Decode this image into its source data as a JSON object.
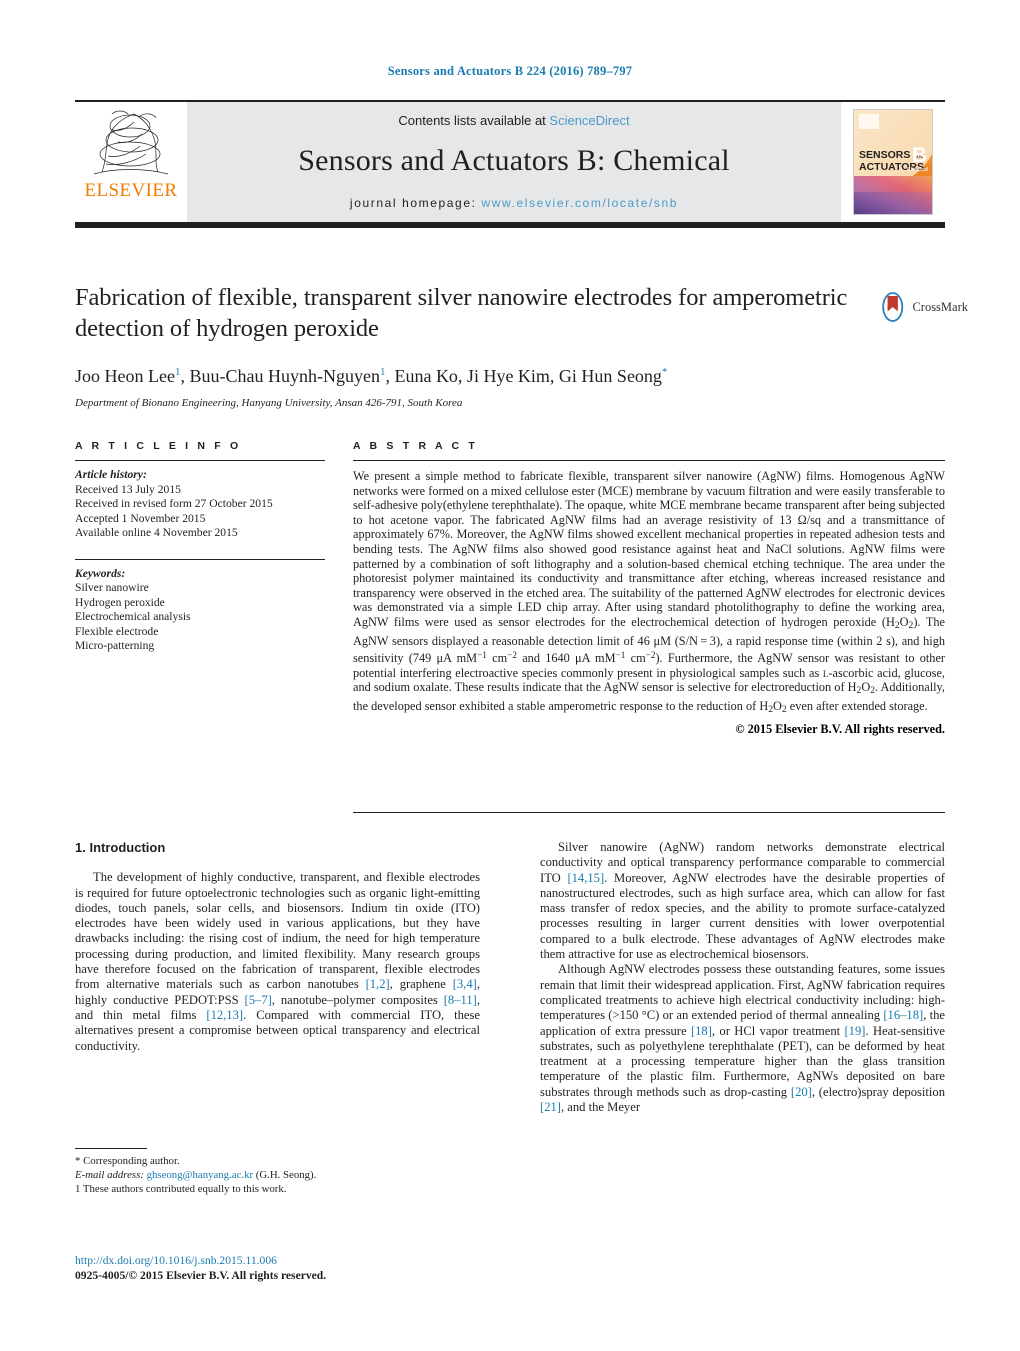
{
  "running_head": "Sensors and Actuators B 224 (2016) 789–797",
  "masthead": {
    "publisher": "ELSEVIER",
    "contents_prefix": "Contents lists available at ",
    "contents_link": "ScienceDirect",
    "journal_name": "Sensors and Actuators B: Chemical",
    "homepage_prefix": "journal homepage: ",
    "homepage_url": "www.elsevier.com/locate/snb",
    "cover": {
      "line1": "SENSORS",
      "line1_small": "and",
      "line2": "ACTUATORS",
      "letter": "B",
      "letter_sub": "Chemical"
    }
  },
  "article": {
    "title": "Fabrication of flexible, transparent silver nanowire electrodes for amperometric detection of hydrogen peroxide",
    "authors_html": "Joo Heon Lee<sup>1</sup>, Buu-Chau Huynh-Nguyen<sup>1</sup>, Euna Ko, Ji Hye Kim, Gi Hun Seong<sup class=\"star\">*</sup>",
    "affiliation": "Department of Bionano Engineering, Hanyang University, Ansan 426-791, South Korea",
    "crossmark_label": "CrossMark"
  },
  "article_info": {
    "label": "A R T I C L E   I N F O",
    "history_head": "Article history:",
    "history": [
      "Received 13 July 2015",
      "Received in revised form 27 October 2015",
      "Accepted 1 November 2015",
      "Available online 4 November 2015"
    ],
    "keywords_head": "Keywords:",
    "keywords": [
      "Silver nanowire",
      "Hydrogen peroxide",
      "Electrochemical analysis",
      "Flexible electrode",
      "Micro-patterning"
    ]
  },
  "abstract": {
    "label": "A B S T R A C T",
    "text_html": "We present a simple method to fabricate flexible, transparent silver nanowire (AgNW) films. Homogenous AgNW networks were formed on a mixed cellulose ester (MCE) membrane by vacuum filtration and were easily transferable to self-adhesive poly(ethylene terephthalate). The opaque, white MCE membrane became transparent after being subjected to hot acetone vapor. The fabricated AgNW films had an average resistivity of 13 &#937;/sq and a transmittance of approximately 67%. Moreover, the AgNW films showed excellent mechanical properties in repeated adhesion tests and bending tests. The AgNW films also showed good resistance against heat and NaCl solutions. AgNW films were patterned by a combination of soft lithography and a solution-based chemical etching technique. The area under the photoresist polymer maintained its conductivity and transmittance after etching, whereas increased resistance and transparency were observed in the etched area. The suitability of the patterned AgNW electrodes for electronic devices was demonstrated via a simple LED chip array. After using standard photolithography to define the working area, AgNW films were used as sensor electrodes for the electrochemical detection of hydrogen peroxide (H<span class=\"sub\">2</span>O<span class=\"sub\">2</span>). The AgNW sensors displayed a reasonable detection limit of 46 &#956;M (S/N&#8201;=&#8201;3), a rapid response time (within 2 s), and high sensitivity (749 &#956;A mM<span class=\"sup\">&#8722;1</span> cm<span class=\"sup\">&#8722;2</span> and 1640 &#956;A mM<span class=\"sup\">&#8722;1</span> cm<span class=\"sup\">&#8722;2</span>). Furthermore, the AgNW sensor was resistant to other potential interfering electroactive species commonly present in physiological samples such as <span class=\"smallcaps\">l</span>-ascorbic acid, glucose, and sodium oxalate. These results indicate that the AgNW sensor is selective for electroreduction of H<span class=\"sub\">2</span>O<span class=\"sub\">2</span>. Additionally, the developed sensor exhibited a stable amperometric response to the reduction of H<span class=\"sub\">2</span>O<span class=\"sub\">2</span> even after extended storage.",
    "copyright": "© 2015 Elsevier B.V. All rights reserved."
  },
  "body": {
    "section_heading": "1.  Introduction",
    "left_paragraph_html": "The development of highly conductive, transparent, and flexible electrodes is required for future optoelectronic technologies such as organic light-emitting diodes, touch panels, solar cells, and biosensors. Indium tin oxide (ITO) electrodes have been widely used in various applications, but they have drawbacks including: the rising cost of indium, the need for high temperature processing during production, and limited flexibility. Many research groups have therefore focused on the fabrication of transparent, flexible electrodes from alternative materials such as carbon nanotubes <span class=\"ref\">[1,2]</span>, graphene <span class=\"ref\">[3,4]</span>, highly conductive PEDOT:PSS <span class=\"ref\">[5–7]</span>, nanotube–polymer composites <span class=\"ref\">[8–11]</span>, and thin metal films <span class=\"ref\">[12,13]</span>. Compared with commercial ITO, these alternatives present a compromise between optical transparency and electrical conductivity.",
    "right_paragraph_1_html": "Silver nanowire (AgNW) random networks demonstrate electrical conductivity and optical transparency performance comparable to commercial ITO <span class=\"ref\">[14,15]</span>. Moreover, AgNW electrodes have the desirable properties of nanostructured electrodes, such as high surface area, which can allow for fast mass transfer of redox species, and the ability to promote surface-catalyzed processes resulting in larger current densities with lower overpotential compared to a bulk electrode. These advantages of AgNW electrodes make them attractive for use as electrochemical biosensors.",
    "right_paragraph_2_html": "Although AgNW electrodes possess these outstanding features, some issues remain that limit their widespread application. First, AgNW fabrication requires complicated treatments to achieve high electrical conductivity including: high-temperatures (&gt;150 °C) or an extended period of thermal annealing <span class=\"ref\">[16–18]</span>, the application of extra pressure <span class=\"ref\">[18]</span>, or HCl vapor treatment <span class=\"ref\">[19]</span>. Heat-sensitive substrates, such as polyethylene terephthalate (PET), can be deformed by heat treatment at a processing temperature higher than the glass transition temperature of the plastic film. Furthermore, AgNWs deposited on bare substrates through methods such as drop-casting <span class=\"ref\">[20]</span>, (electro)spray deposition <span class=\"ref\">[21]</span>, and the Meyer"
  },
  "footnotes": {
    "corresponding": "* Corresponding author.",
    "email_label": "E-mail address:",
    "email": "ghseong@hanyang.ac.kr",
    "email_suffix": "(G.H. Seong).",
    "equal_contribution": "1  These authors contributed equally to this work."
  },
  "footer": {
    "doi": "http://dx.doi.org/10.1016/j.snb.2015.11.006",
    "issn_line": "0925-4005/© 2015 Elsevier B.V. All rights reserved."
  }
}
